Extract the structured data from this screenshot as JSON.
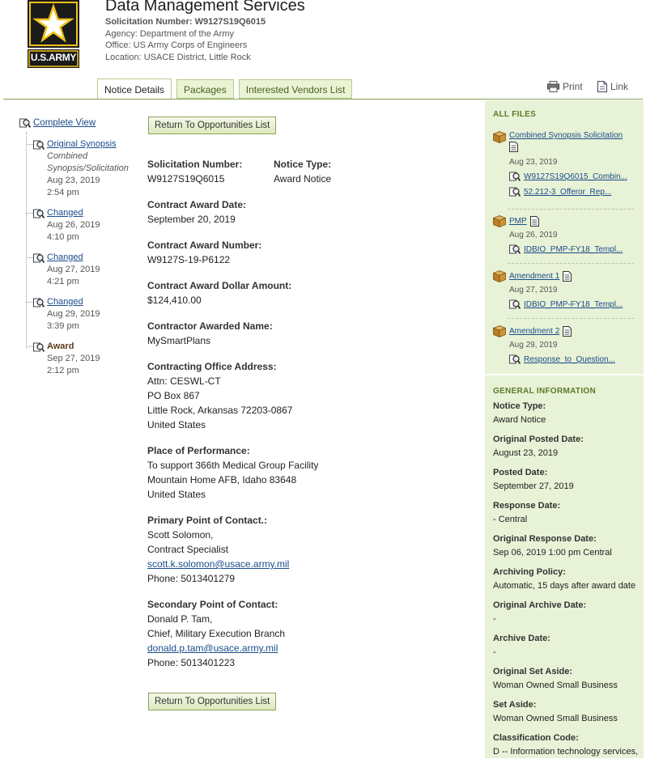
{
  "header": {
    "title": "Data Management Services",
    "solicitation": "Solicitation Number: W9127S19Q6015",
    "agency": "Agency: Department of the Army",
    "office": "Office: US Army Corps of Engineers",
    "location": "Location: USACE District, Little Rock",
    "logo_text": "U.S.ARMY"
  },
  "tabs": [
    "Notice Details",
    "Packages",
    "Interested Vendors List"
  ],
  "actions": {
    "print": "Print",
    "link": "Link"
  },
  "tree": {
    "complete_view": "Complete View",
    "items": [
      {
        "title": "Original Synopsis",
        "line1": "Combined",
        "line2": "Synopsis/Solicitation",
        "date": "Aug 23, 2019",
        "time": "2:54 pm"
      },
      {
        "title": "Changed",
        "date": "Aug 26, 2019",
        "time": "4:10 pm"
      },
      {
        "title": "Changed",
        "date": "Aug 27, 2019",
        "time": "4:21 pm"
      },
      {
        "title": "Changed",
        "date": "Aug 29, 2019",
        "time": "3:39 pm"
      },
      {
        "title": "Award",
        "date": "Sep 27, 2019",
        "time": "2:12 pm"
      }
    ]
  },
  "buttons": {
    "return": "Return To Opportunities List"
  },
  "main": {
    "sol_label": "Solicitation Number:",
    "sol_value": "W9127S19Q6015",
    "type_label": "Notice Type:",
    "type_value": "Award Notice",
    "award_date_label": "Contract Award Date:",
    "award_date_value": "September 20, 2019",
    "award_num_label": "Contract Award Number:",
    "award_num_value": "W9127S-19-P6122",
    "amount_label": "Contract Award Dollar Amount:",
    "amount_value": "$124,410.00",
    "awardee_label": "Contractor Awarded Name:",
    "awardee_value": "MySmartPlans",
    "office_label": "Contracting Office Address:",
    "office_lines": [
      "Attn: CESWL-CT",
      "PO Box 867",
      "Little Rock, Arkansas 72203-0867",
      "United States"
    ],
    "perf_label": "Place of Performance:",
    "perf_lines": [
      "To support 366th Medical Group Facility",
      "Mountain Home AFB, Idaho 83648",
      "United States"
    ],
    "poc1_label": "Primary Point of Contact.:",
    "poc1_name": "Scott Solomon,",
    "poc1_title": "Contract Specialist",
    "poc1_email": "scott.k.solomon@usace.army.mil",
    "poc1_phone": "Phone: 5013401279",
    "poc2_label": "Secondary Point of Contact:",
    "poc2_name": "Donald P. Tam,",
    "poc2_title": "Chief, Military Execution Branch",
    "poc2_email": "donald.p.tam@usace.army.mil",
    "poc2_phone": "Phone: 5013401223"
  },
  "sidebar": {
    "all_files": "ALL FILES",
    "files": [
      {
        "name": "Combined Synopsis Solicitation",
        "date": "Aug 23, 2019",
        "subs": [
          "W9127S19Q6015_Combin...",
          "52.212-3_Offeror_Rep..."
        ]
      },
      {
        "name": "PMP",
        "date": "Aug 26, 2019",
        "subs": [
          "IDBIO_PMP-FY18_Templ..."
        ]
      },
      {
        "name": "Amendment 1",
        "date": "Aug 27, 2019",
        "subs": [
          "IDBIO_PMP-FY18_Templ..."
        ]
      },
      {
        "name": "Amendment 2",
        "date": "Aug 29, 2019",
        "subs": [
          "Response_to_Question..."
        ]
      }
    ],
    "general": "GENERAL INFORMATION",
    "info": [
      {
        "label": "Notice Type:",
        "value": "Award Notice"
      },
      {
        "label": "Original Posted Date:",
        "value": "August 23, 2019"
      },
      {
        "label": "Posted Date:",
        "value": "September 27, 2019"
      },
      {
        "label": "Response Date:",
        "value": "- Central"
      },
      {
        "label": "Original Response Date:",
        "value": "Sep 06, 2019 1:00 pm Central"
      },
      {
        "label": "Archiving Policy:",
        "value": "Automatic, 15 days after award date"
      },
      {
        "label": "Original Archive Date:",
        "value": "-"
      },
      {
        "label": "Archive Date:",
        "value": "-"
      },
      {
        "label": "Original Set Aside:",
        "value": "Woman Owned Small Business"
      },
      {
        "label": "Set Aside:",
        "value": "Woman Owned Small Business"
      },
      {
        "label": "Classification Code:",
        "value": "D -- Information technology services,"
      }
    ]
  }
}
